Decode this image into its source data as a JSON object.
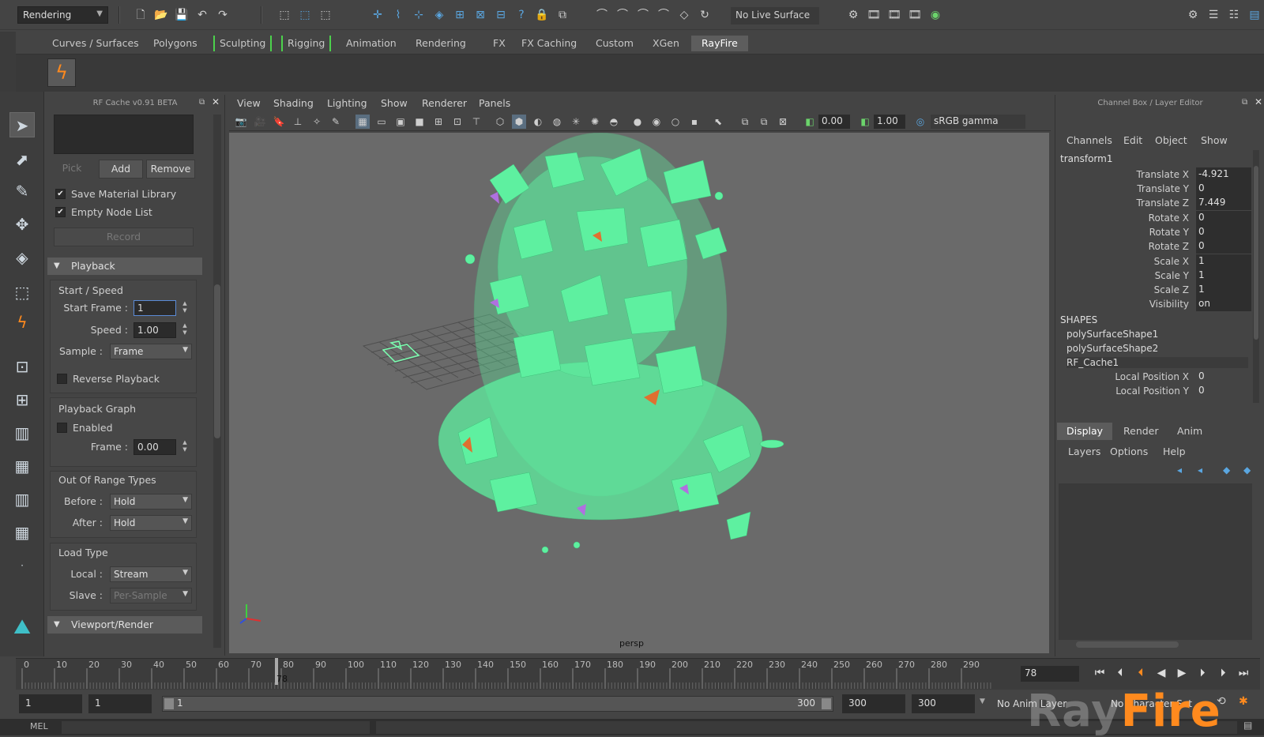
{
  "toolbar": {
    "mode": "Rendering",
    "live_surface": "No Live Surface"
  },
  "shelf": {
    "tabs": [
      "Curves / Surfaces",
      "Polygons",
      "Sculpting",
      "Rigging",
      "Animation",
      "Rendering",
      "FX",
      "FX Caching",
      "Custom",
      "XGen",
      "RayFire"
    ],
    "active_tab": "RayFire"
  },
  "rf_cache": {
    "title": "RF Cache v0.91 BETA",
    "pick": "Pick",
    "add": "Add",
    "remove": "Remove",
    "save_material_library": "Save Material Library",
    "empty_node_list": "Empty Node List",
    "record": "Record",
    "playback": {
      "section": "Playback",
      "start_speed": "Start / Speed",
      "start_frame_label": "Start Frame :",
      "start_frame": "1",
      "speed_label": "Speed :",
      "speed": "1.00",
      "sample_label": "Sample :",
      "sample": "Frame",
      "reverse_playback": "Reverse Playback",
      "graph_title": "Playback Graph",
      "enabled": "Enabled",
      "frame_label": "Frame :",
      "frame": "0.00"
    },
    "out_of_range": {
      "title": "Out Of Range Types",
      "before_label": "Before :",
      "before": "Hold",
      "after_label": "After :",
      "after": "Hold"
    },
    "load_type": {
      "title": "Load Type",
      "local_label": "Local :",
      "local": "Stream",
      "slave_label": "Slave :",
      "slave": "Per-Sample"
    },
    "viewport_render": "Viewport/Render"
  },
  "viewport": {
    "menus": [
      "View",
      "Shading",
      "Lighting",
      "Show",
      "Renderer",
      "Panels"
    ],
    "gamma_value_1": "0.00",
    "gamma_value_2": "1.00",
    "color_space": "sRGB gamma",
    "camera": "persp"
  },
  "channel_box": {
    "title": "Channel Box / Layer Editor",
    "menus": [
      "Channels",
      "Edit",
      "Object",
      "Show"
    ],
    "object": "transform1",
    "attributes": [
      {
        "name": "Translate X",
        "value": "-4.921"
      },
      {
        "name": "Translate Y",
        "value": "0"
      },
      {
        "name": "Translate Z",
        "value": "7.449"
      },
      {
        "name": "Rotate X",
        "value": "0"
      },
      {
        "name": "Rotate Y",
        "value": "0"
      },
      {
        "name": "Rotate Z",
        "value": "0"
      },
      {
        "name": "Scale X",
        "value": "1"
      },
      {
        "name": "Scale Y",
        "value": "1"
      },
      {
        "name": "Scale Z",
        "value": "1"
      },
      {
        "name": "Visibility",
        "value": "on"
      }
    ],
    "shapes_title": "SHAPES",
    "shapes": [
      "polySurfaceShape1",
      "polySurfaceShape2",
      "RF_Cache1"
    ],
    "cache_attrs": [
      {
        "name": "Local Position X",
        "value": "0"
      },
      {
        "name": "Local Position Y",
        "value": "0"
      }
    ]
  },
  "layer_editor": {
    "tabs": [
      "Display",
      "Render",
      "Anim"
    ],
    "active_tab": "Display",
    "menus": [
      "Layers",
      "Options",
      "Help"
    ]
  },
  "timeline": {
    "ticks": [
      "0",
      "10",
      "20",
      "30",
      "40",
      "50",
      "60",
      "70",
      "80",
      "90",
      "100",
      "110",
      "120",
      "130",
      "140",
      "150",
      "160",
      "170",
      "180",
      "190",
      "200",
      "210",
      "220",
      "230",
      "240",
      "250",
      "260",
      "270",
      "280",
      "290"
    ],
    "current_marker": "78",
    "current_frame": "78"
  },
  "range": {
    "start": "1",
    "start2": "1",
    "slider_start": "1",
    "slider_end": "300",
    "end": "300",
    "end2": "300",
    "anim_layer": "No Anim Layer",
    "char_set": "No Character Set"
  },
  "command": {
    "label": "MEL"
  },
  "watermark": {
    "part1": "Ray",
    "part2": "Fire"
  }
}
